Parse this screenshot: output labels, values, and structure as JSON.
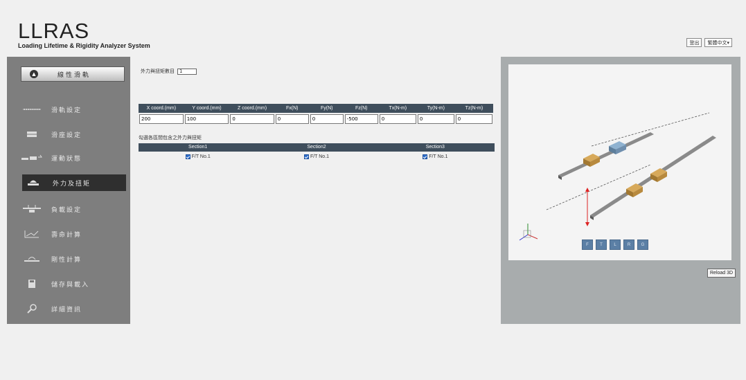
{
  "header": {
    "logo_main": "LLRAS",
    "logo_sub": "Loading Lifetime & Rigidity Analyzer System",
    "top_button": "登出",
    "language_selected": "繁體中文▾"
  },
  "sidebar": {
    "top_label": "線性滑軌",
    "items": [
      {
        "label": "滑軌設定",
        "icon": "rail-icon"
      },
      {
        "label": "滑座設定",
        "icon": "block-icon"
      },
      {
        "label": "運動狀態",
        "icon": "motion-icon"
      },
      {
        "label": "外力及扭矩",
        "icon": "force-icon",
        "active": true
      },
      {
        "label": "負載設定",
        "icon": "load-icon"
      },
      {
        "label": "壽命計算",
        "icon": "life-icon"
      },
      {
        "label": "剛性計算",
        "icon": "rigidity-icon"
      },
      {
        "label": "儲存與載入",
        "icon": "save-icon"
      },
      {
        "label": "詳細資訊",
        "icon": "search-icon"
      }
    ]
  },
  "main": {
    "count_label": "外力與扭矩數目",
    "count_value": "1",
    "table": {
      "headers": [
        "X coord.(mm)",
        "Y coord.(mm)",
        "Z coord.(mm)",
        "Fx(N)",
        "Fy(N)",
        "Fz(N)",
        "Tx(N-m)",
        "Ty(N-m)",
        "Tz(N-m)"
      ],
      "values": [
        "200",
        "100",
        "0",
        "0",
        "0",
        "-500",
        "0",
        "0",
        "0"
      ]
    },
    "sections_title": "勾選各區間包含之外力與扭矩",
    "sections": [
      {
        "name": "Section1",
        "item": "F/T No.1"
      },
      {
        "name": "Section2",
        "item": "F/T No.1"
      },
      {
        "name": "Section3",
        "item": "F/T No.1"
      }
    ]
  },
  "viewer": {
    "view_buttons": [
      "F",
      "T",
      "L",
      "R",
      "G"
    ],
    "reload_label": "Reload 3D",
    "colors": {
      "rail": "#6f6f6f",
      "block": "#b08838",
      "block_selected": "#6f8fae",
      "force_arrow": "#d22"
    }
  }
}
